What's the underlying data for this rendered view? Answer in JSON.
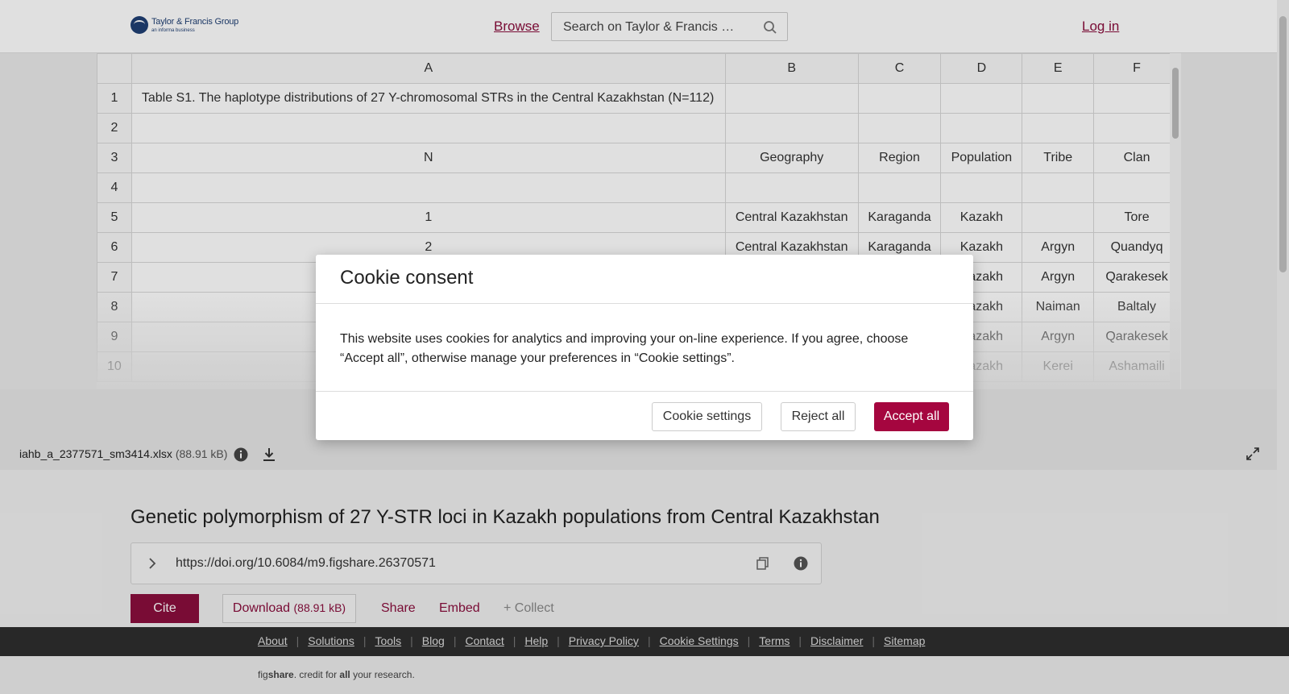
{
  "header": {
    "logo_main": "Taylor & Francis Group",
    "logo_sub": "an informa business",
    "browse_label": "Browse",
    "search_placeholder": "Search on Taylor & Francis …",
    "login_label": "Log in"
  },
  "sheet": {
    "columns": [
      "A",
      "B",
      "C",
      "D",
      "E",
      "F"
    ],
    "rows": [
      {
        "n": "1",
        "cells": [
          "Table S1. The haplotype distributions of 27 Y-chromosomal STRs in the Central Kazakhstan (N=112)",
          "",
          "",
          "",
          "",
          ""
        ]
      },
      {
        "n": "2",
        "cells": [
          "",
          "",
          "",
          "",
          "",
          ""
        ]
      },
      {
        "n": "3",
        "cells": [
          "N",
          "Geography",
          "Region",
          "Population",
          "Tribe",
          "Clan"
        ]
      },
      {
        "n": "4",
        "cells": [
          "",
          "",
          "",
          "",
          "",
          ""
        ]
      },
      {
        "n": "5",
        "cells": [
          "1",
          "Central Kazakhstan",
          "Karaganda",
          "Kazakh",
          "",
          "Tore"
        ]
      },
      {
        "n": "6",
        "cells": [
          "2",
          "Central Kazakhstan",
          "Karaganda",
          "Kazakh",
          "Argyn",
          "Quandyq"
        ]
      },
      {
        "n": "7",
        "cells": [
          "",
          "",
          "",
          "Kazakh",
          "Argyn",
          "Qarakesek"
        ]
      },
      {
        "n": "8",
        "cells": [
          "",
          "",
          "",
          "Kazakh",
          "Naiman",
          "Baltaly"
        ]
      },
      {
        "n": "9",
        "cells": [
          "",
          "",
          "",
          "Kazakh",
          "Argyn",
          "Qarakesek"
        ]
      },
      {
        "n": "10",
        "cells": [
          "",
          "",
          "",
          "Kazakh",
          "Kerei",
          "Ashamaili"
        ]
      }
    ]
  },
  "file": {
    "name": "iahb_a_2377571_sm3414.xlsx",
    "size": "(88.91 kB)"
  },
  "article": {
    "title": "Genetic polymorphism of 27 Y-STR loci in Kazakh populations from Central Kazakhstan",
    "doi": "https://doi.org/10.6084/m9.figshare.26370571",
    "cite_label": "Cite",
    "download_label": "Download",
    "download_size": "(88.91 kB)",
    "share_label": "Share",
    "embed_label": "Embed",
    "collect_label": "+ Collect"
  },
  "footer": {
    "links": [
      "About",
      "Solutions",
      "Tools",
      "Blog",
      "Contact",
      "Help",
      "Privacy Policy",
      "Cookie Settings",
      "Terms",
      "Disclaimer",
      "Sitemap"
    ],
    "credit_fig": "fig",
    "credit_share": "share",
    "credit_mid": ". credit for ",
    "credit_all": "all",
    "credit_end": " your research."
  },
  "cookie": {
    "title": "Cookie consent",
    "body": "This website uses cookies for analytics and improving your on-line experience. If you agree, choose “Accept all”, otherwise manage your preferences in “Cookie settings”.",
    "settings_label": "Cookie settings",
    "reject_label": "Reject all",
    "accept_label": "Accept all"
  },
  "colors": {
    "brand": "#8a0e3d",
    "accept": "#a5063f",
    "footer_bg": "#2e2e2e"
  }
}
